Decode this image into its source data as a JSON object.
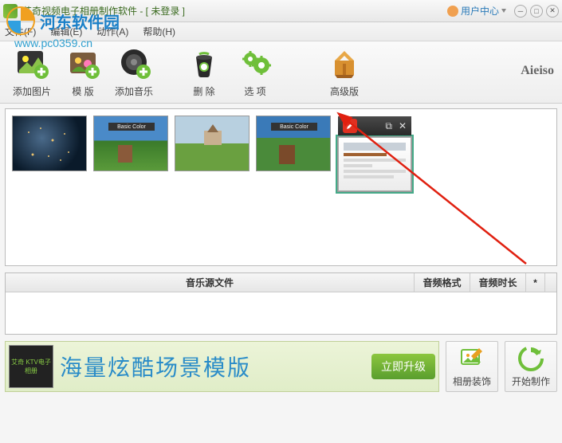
{
  "titlebar": {
    "title": "艾奇视频电子相册制作软件 - [ 未登录 ]",
    "user_center": "用户中心"
  },
  "menus": {
    "file": "文件(F)",
    "edit": "编辑(E)",
    "action": "动作(A)",
    "help": "帮助(H)"
  },
  "toolbar": {
    "add_image": "添加图片",
    "template": "模 版",
    "add_music": "添加音乐",
    "delete": "删 除",
    "options": "选 项",
    "premium": "高级版"
  },
  "brand": "Aieiso",
  "music_table": {
    "col_source": "音乐源文件",
    "col_format": "音频格式",
    "col_duration": "音频时长",
    "col_star": "*",
    "rows": []
  },
  "banner": {
    "thumb_text": "艾奇\nKTV电子相册",
    "headline": "海量炫酷场景模版",
    "button": "立即升级"
  },
  "actions": {
    "decorate": "相册装饰",
    "start": "开始制作"
  },
  "watermark": {
    "brand": "河东软件园",
    "url": "www.pc0359.cn"
  },
  "thumbnails": [
    {
      "id": 1,
      "selected": false
    },
    {
      "id": 2,
      "selected": false
    },
    {
      "id": 3,
      "selected": false
    },
    {
      "id": 4,
      "selected": false
    },
    {
      "id": 5,
      "selected": true
    }
  ]
}
